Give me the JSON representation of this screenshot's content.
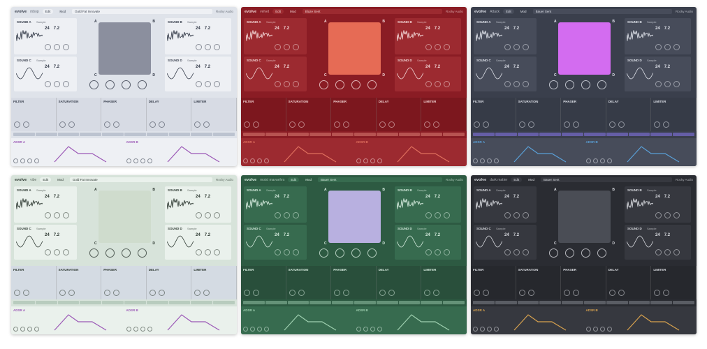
{
  "themes": [
    {
      "brand": "evolve",
      "preset": "mbop",
      "tab1": "Edit",
      "tab2": "Mod",
      "preset_name": "Gold Fat Innovate",
      "vendor": "Rocky Audio",
      "bg": "#dfe3ea",
      "card": "#eef0f4",
      "text": "#333a48",
      "accent": "#9aa3b5",
      "xy": "#8b8f9e",
      "fxbar": "#d7dbe4",
      "env": "#9b58b6"
    },
    {
      "brand": "evolve",
      "preset": "velvet",
      "tab1": "Edit",
      "tab2": "Mod",
      "preset_name": "Blaze Sent",
      "vendor": "Rocky Audio",
      "bg": "#8a1c24",
      "card": "#9c2a30",
      "text": "#f3d8d8",
      "accent": "#e38a7e",
      "xy": "#e66b55",
      "fxbar": "#7c171e",
      "env": "#e0705e"
    },
    {
      "brand": "evolve",
      "preset": "Attack",
      "tab1": "Edit",
      "tab2": "Mod",
      "preset_name": "Bauer Sent",
      "vendor": "Rocky Audio",
      "bg": "#3a3f4c",
      "card": "#474c5a",
      "text": "#dfe2ea",
      "accent": "#8f7dff",
      "xy": "#d36cf0",
      "fxbar": "#363b47",
      "env": "#5aa0d8"
    },
    {
      "brand": "evolve",
      "preset": "vibe",
      "tab1": "Edit",
      "tab2": "Mod",
      "preset_name": "Gold Fat Innovate",
      "vendor": "Rocky Audio",
      "bg": "#d7e3da",
      "card": "#eaf1ec",
      "text": "#2f3a33",
      "accent": "#9ab5a2",
      "xy": "#cfdccd",
      "fxbar": "#d4dbe3",
      "env": "#9b58b6"
    },
    {
      "brand": "evolve",
      "preset": "moist mavuehrs",
      "tab1": "Edit",
      "tab2": "Mod",
      "preset_name": "Bauer Sent",
      "vendor": "Rocky Audio",
      "bg": "#2d5a42",
      "card": "#376b4f",
      "text": "#d6ebde",
      "accent": "#9ec9ad",
      "xy": "#b8b0e0",
      "fxbar": "#294f3b",
      "env": "#9fd0b0"
    },
    {
      "brand": "evolve",
      "preset": "dark matter",
      "tab1": "Edit",
      "tab2": "Mod",
      "preset_name": "Bauer Sent",
      "vendor": "Rocky Audio",
      "bg": "#2a2c32",
      "card": "#36383f",
      "text": "#d9dbe0",
      "accent": "#8a8d96",
      "xy": "#4a4d55",
      "fxbar": "#26282d",
      "env": "#d8a24e"
    }
  ],
  "sounds": {
    "a": "SOUND A",
    "b": "SOUND B",
    "c": "SOUND C",
    "d": "SOUND D",
    "tab": "Sample",
    "val1": "24",
    "val2": "7.2"
  },
  "xy_labels": {
    "a": "A",
    "b": "B",
    "c": "C",
    "d": "D"
  },
  "fx": {
    "filter": "FILTER",
    "saturation": "SATURATION",
    "phaser": "PHASER",
    "delay": "DELAY",
    "limiter": "LIMITER"
  },
  "env": {
    "a": "ADSR A",
    "b": "ADSR B"
  }
}
